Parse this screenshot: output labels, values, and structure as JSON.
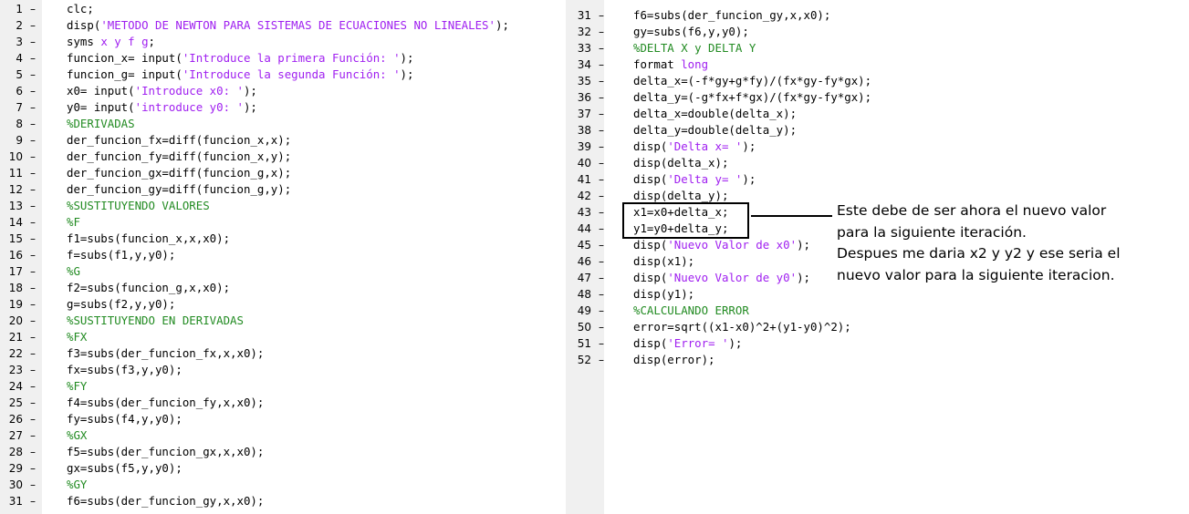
{
  "colors": {
    "string": "#a020f0",
    "comment": "#228b22",
    "keyword": "#0000ff",
    "gutter": "#f0f0f0"
  },
  "left_pane": {
    "lines": [
      {
        "n": "1",
        "segs": [
          {
            "t": "clc;",
            "c": ""
          }
        ]
      },
      {
        "n": "2",
        "segs": [
          {
            "t": "disp(",
            "c": ""
          },
          {
            "t": "'METODO DE NEWTON PARA SISTEMAS DE ECUACIONES NO LINEALES'",
            "c": "str"
          },
          {
            "t": ");",
            "c": ""
          }
        ]
      },
      {
        "n": "3",
        "segs": [
          {
            "t": "syms ",
            "c": ""
          },
          {
            "t": "x y f g",
            "c": "str"
          },
          {
            "t": ";",
            "c": ""
          }
        ]
      },
      {
        "n": "4",
        "segs": [
          {
            "t": "funcion_x= input(",
            "c": ""
          },
          {
            "t": "'Introduce la primera Función: '",
            "c": "str"
          },
          {
            "t": ");",
            "c": ""
          }
        ]
      },
      {
        "n": "5",
        "segs": [
          {
            "t": "funcion_g= input(",
            "c": ""
          },
          {
            "t": "'Introduce la segunda Función: '",
            "c": "str"
          },
          {
            "t": ");",
            "c": ""
          }
        ]
      },
      {
        "n": "6",
        "segs": [
          {
            "t": "x0= input(",
            "c": ""
          },
          {
            "t": "'Introduce x0: '",
            "c": "str"
          },
          {
            "t": ");",
            "c": ""
          }
        ]
      },
      {
        "n": "7",
        "segs": [
          {
            "t": "y0= input(",
            "c": ""
          },
          {
            "t": "'introduce y0: '",
            "c": "str"
          },
          {
            "t": ");",
            "c": ""
          }
        ]
      },
      {
        "n": "8",
        "segs": [
          {
            "t": "%DERIVADAS",
            "c": "com"
          }
        ]
      },
      {
        "n": "9",
        "segs": [
          {
            "t": "der_funcion_fx=diff(funcion_x,x);",
            "c": ""
          }
        ]
      },
      {
        "n": "10",
        "segs": [
          {
            "t": "der_funcion_fy=diff(funcion_x,y);",
            "c": ""
          }
        ]
      },
      {
        "n": "11",
        "segs": [
          {
            "t": "der_funcion_gx=diff(funcion_g,x);",
            "c": ""
          }
        ]
      },
      {
        "n": "12",
        "segs": [
          {
            "t": "der_funcion_gy=diff(funcion_g,y);",
            "c": ""
          }
        ]
      },
      {
        "n": "13",
        "segs": [
          {
            "t": "%SUSTITUYENDO VALORES",
            "c": "com"
          }
        ]
      },
      {
        "n": "14",
        "segs": [
          {
            "t": "%F",
            "c": "com"
          }
        ]
      },
      {
        "n": "15",
        "segs": [
          {
            "t": "f1=subs(funcion_x,x,x0);",
            "c": ""
          }
        ]
      },
      {
        "n": "16",
        "segs": [
          {
            "t": "f=subs(f1,y,y0);",
            "c": ""
          }
        ]
      },
      {
        "n": "17",
        "segs": [
          {
            "t": "%G",
            "c": "com"
          }
        ]
      },
      {
        "n": "18",
        "segs": [
          {
            "t": "f2=subs(funcion_g,x,x0);",
            "c": ""
          }
        ]
      },
      {
        "n": "19",
        "segs": [
          {
            "t": "g=subs(f2,y,y0);",
            "c": ""
          }
        ]
      },
      {
        "n": "20",
        "segs": [
          {
            "t": "%SUSTITUYENDO EN DERIVADAS",
            "c": "com"
          }
        ]
      },
      {
        "n": "21",
        "segs": [
          {
            "t": "%FX",
            "c": "com"
          }
        ]
      },
      {
        "n": "22",
        "segs": [
          {
            "t": "f3=subs(der_funcion_fx,x,x0);",
            "c": ""
          }
        ]
      },
      {
        "n": "23",
        "segs": [
          {
            "t": "fx=subs(f3,y,y0);",
            "c": ""
          }
        ]
      },
      {
        "n": "24",
        "segs": [
          {
            "t": "%FY",
            "c": "com"
          }
        ]
      },
      {
        "n": "25",
        "segs": [
          {
            "t": "f4=subs(der_funcion_fy,x,x0);",
            "c": ""
          }
        ]
      },
      {
        "n": "26",
        "segs": [
          {
            "t": "fy=subs(f4,y,y0);",
            "c": ""
          }
        ]
      },
      {
        "n": "27",
        "segs": [
          {
            "t": "%GX",
            "c": "com"
          }
        ]
      },
      {
        "n": "28",
        "segs": [
          {
            "t": "f5=subs(der_funcion_gx,x,x0);",
            "c": ""
          }
        ]
      },
      {
        "n": "29",
        "segs": [
          {
            "t": "gx=subs(f5,y,y0);",
            "c": ""
          }
        ]
      },
      {
        "n": "30",
        "segs": [
          {
            "t": "%GY",
            "c": "com"
          }
        ]
      },
      {
        "n": "31",
        "segs": [
          {
            "t": "f6=subs(der_funcion_gy,x,x0);",
            "c": ""
          }
        ]
      }
    ]
  },
  "right_pane": {
    "lines": [
      {
        "n": "31",
        "segs": [
          {
            "t": "f6=subs(der_funcion_gy,x,x0);",
            "c": ""
          }
        ]
      },
      {
        "n": "32",
        "segs": [
          {
            "t": "gy=subs(f6,y,y0);",
            "c": ""
          }
        ]
      },
      {
        "n": "33",
        "segs": [
          {
            "t": "%DELTA X y DELTA Y",
            "c": "com"
          }
        ]
      },
      {
        "n": "34",
        "segs": [
          {
            "t": "format ",
            "c": ""
          },
          {
            "t": "long",
            "c": "str"
          }
        ]
      },
      {
        "n": "35",
        "segs": [
          {
            "t": "delta_x=(-f*gy+g*fy)/(fx*gy-fy*gx);",
            "c": ""
          }
        ]
      },
      {
        "n": "36",
        "segs": [
          {
            "t": "delta_y=(-g*fx+f*gx)/(fx*gy-fy*gx);",
            "c": ""
          }
        ]
      },
      {
        "n": "37",
        "segs": [
          {
            "t": "delta_x=double(delta_x);",
            "c": ""
          }
        ]
      },
      {
        "n": "38",
        "segs": [
          {
            "t": "delta_y=double(delta_y);",
            "c": ""
          }
        ]
      },
      {
        "n": "39",
        "segs": [
          {
            "t": "disp(",
            "c": ""
          },
          {
            "t": "'Delta x= '",
            "c": "str"
          },
          {
            "t": ");",
            "c": ""
          }
        ]
      },
      {
        "n": "40",
        "segs": [
          {
            "t": "disp(delta_x);",
            "c": ""
          }
        ]
      },
      {
        "n": "41",
        "segs": [
          {
            "t": "disp(",
            "c": ""
          },
          {
            "t": "'Delta y= '",
            "c": "str"
          },
          {
            "t": ");",
            "c": ""
          }
        ]
      },
      {
        "n": "42",
        "segs": [
          {
            "t": "disp(delta_y);",
            "c": ""
          }
        ]
      },
      {
        "n": "43",
        "segs": [
          {
            "t": "x1=x0+delta_x;",
            "c": ""
          }
        ]
      },
      {
        "n": "44",
        "segs": [
          {
            "t": "y1=y0+delta_y;",
            "c": ""
          }
        ]
      },
      {
        "n": "45",
        "segs": [
          {
            "t": "disp(",
            "c": ""
          },
          {
            "t": "'Nuevo Valor de x0'",
            "c": "str"
          },
          {
            "t": ");",
            "c": ""
          }
        ]
      },
      {
        "n": "46",
        "segs": [
          {
            "t": "disp(x1);",
            "c": ""
          }
        ]
      },
      {
        "n": "47",
        "segs": [
          {
            "t": "disp(",
            "c": ""
          },
          {
            "t": "'Nuevo Valor de y0'",
            "c": "str"
          },
          {
            "t": ");",
            "c": ""
          }
        ]
      },
      {
        "n": "48",
        "segs": [
          {
            "t": "disp(y1);",
            "c": ""
          }
        ]
      },
      {
        "n": "49",
        "segs": [
          {
            "t": "%CALCULANDO ERROR",
            "c": "com"
          }
        ]
      },
      {
        "n": "50",
        "segs": [
          {
            "t": "error=sqrt((x1-x0)^2+(y1-y0)^2);",
            "c": ""
          }
        ]
      },
      {
        "n": "51",
        "segs": [
          {
            "t": "disp(",
            "c": ""
          },
          {
            "t": "'Error= '",
            "c": "str"
          },
          {
            "t": ");",
            "c": ""
          }
        ]
      },
      {
        "n": "52",
        "segs": [
          {
            "t": "disp(error);",
            "c": ""
          }
        ]
      }
    ]
  },
  "annotation": {
    "line1": "Este debe de ser ahora el nuevo valor",
    "line2": "para la siguiente iteración.",
    "line3": "Despues me daria x2 y y2 y ese seria el",
    "line4": "nuevo valor para la siguiente iteracion."
  }
}
